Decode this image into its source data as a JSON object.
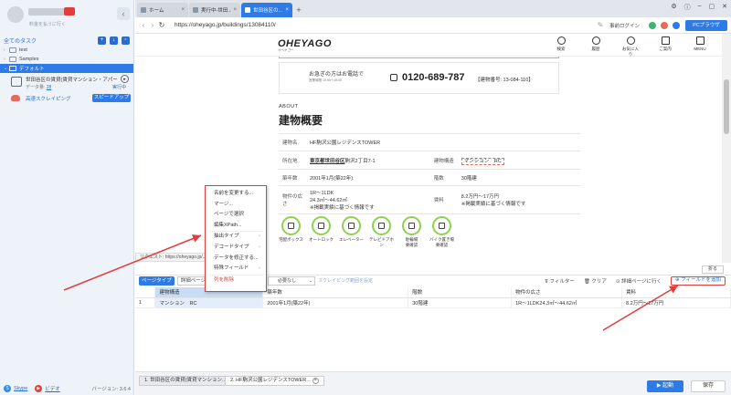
{
  "sidebar": {
    "plan_text": "料金を払うに行く",
    "all_tasks": "全てのタスク",
    "folders": [
      {
        "label": "test"
      },
      {
        "label": "Samples"
      },
      {
        "label": "デフォルト"
      }
    ],
    "task": {
      "name": "世田谷区の賃貸(賃貸マンション・アパート...",
      "data_label": "データ量:",
      "data_count": "28",
      "status": "実行中"
    },
    "cloud_label": "高速スクレイピング",
    "speedup_label": "スピードアップ",
    "footer": {
      "skype": "Skype",
      "video": "ビデオ",
      "version": "バージョン: 3.6.4"
    }
  },
  "browser": {
    "tabs": [
      {
        "label": "ホーム"
      },
      {
        "label": "実行中-世田..."
      },
      {
        "label": "世田谷区の..."
      }
    ],
    "url": "https://oheyago.jp/buildings/13084110/",
    "login": "事前ログイン",
    "pc_browser": "PCブラウザ",
    "status_url": "リクエスト: https://oheyago.jp/..."
  },
  "site": {
    "logo": "OHEYAGO",
    "logo_sub": "オヘヤゴー",
    "nav": [
      {
        "label": "検索",
        "icon": "search-icon"
      },
      {
        "label": "履歴",
        "icon": "clock-icon"
      },
      {
        "label": "お気に入り",
        "icon": "heart-icon"
      },
      {
        "label": "ご案内",
        "icon": "document-icon"
      },
      {
        "label": "MENU",
        "icon": "menu-icon"
      }
    ],
    "urgent": "お急ぎの方はお電話で",
    "hours": "営業時間 10:00～19:00",
    "phone": "0120-689-787",
    "building_id": "【建物番号: 13-084-110】",
    "about": "ABOUT",
    "about_title": "建物概要",
    "table": {
      "name_k": "建物名",
      "name_v": "HF駒沢公園レジデンスTOWER",
      "addr_k": "所在地",
      "addr_v1": "東京都世田谷区",
      "addr_v2": "駒沢2丁目7-1",
      "struct_k": "建物構造",
      "struct_v": "マンション　RC",
      "year_k": "築年数",
      "year_v": "2001年1月(築22年)",
      "floors_k": "階数",
      "floors_v": "30階建",
      "area_k": "物件の広さ",
      "area_v1": "1R～1LDK",
      "area_v2": "24.3㎡～44.62㎡",
      "area_v3": "※掲載実績に基づく情報です",
      "rent_k": "賃料",
      "rent_v1": "8.2万円～17万円",
      "rent_v2": "※掲載実績に基づく情報です"
    },
    "equipment": [
      {
        "label": "宅配ボックス",
        "label2": ""
      },
      {
        "label": "オートロック",
        "label2": ""
      },
      {
        "label": "エレベーター",
        "label2": ""
      },
      {
        "label": "テレビドアホン",
        "label2": ""
      },
      {
        "label": "駐輪場",
        "label2": "要確認"
      },
      {
        "label": "バイク置き場",
        "label2": "要確認"
      }
    ]
  },
  "context_menu": [
    {
      "label": "名前を変更する..."
    },
    {
      "label": "マージ..."
    },
    {
      "label": "ページで選択"
    },
    {
      "label": "編集XPath..."
    },
    {
      "label": "抽出タイプ",
      "sub": true
    },
    {
      "label": "デコードタイプ",
      "sub": true
    },
    {
      "label": "データを修正する..."
    },
    {
      "label": "特殊フィールド",
      "sub": true
    },
    {
      "label": "列を削除"
    }
  ],
  "data_panel": {
    "collapse": "折る",
    "page_type": "ページタイプ",
    "detail_tab": "詳細ページ",
    "select_value": "必要なし",
    "scroll_range": "スクレイピング範囲を設定",
    "filter": "フィルター",
    "clear": "クリア",
    "go_detail": "詳細ページに行く",
    "add_field": "フィールドを追加",
    "headers": [
      "建物構造",
      "築年数",
      "階数",
      "物件の広さ",
      "賃料"
    ],
    "rows": [
      {
        "idx": "1",
        "cells": [
          "マンション　RC",
          "2001年1月(築22年)",
          "30階建",
          "1R～1LDK24.3㎡～44.62㎡",
          "8.2万円～17万円"
        ]
      }
    ]
  },
  "bottom": {
    "tabs": [
      {
        "label": "1. 世田谷区の賃貸(賃貸マンション..."
      },
      {
        "label": "2. HF駒沢公園レジデンスTOWER..."
      }
    ],
    "launch": "起動",
    "save": "保存"
  },
  "colors": {
    "accent": "#2e7ae6",
    "annotation": "#e23d3d",
    "site_green": "#8fd14f"
  }
}
